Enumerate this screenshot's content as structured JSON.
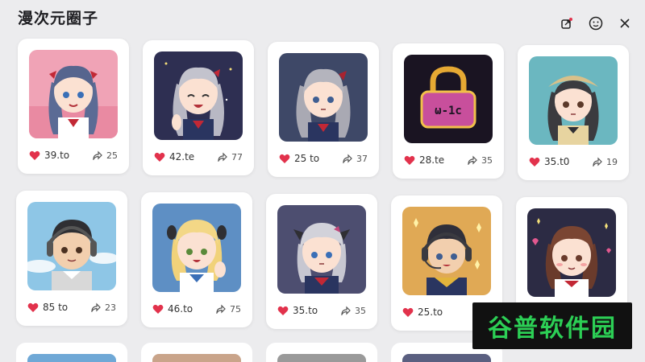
{
  "app": {
    "title": "漫次元圈子"
  },
  "toolbar": {
    "icons": [
      "share-notify-icon",
      "smile-icon",
      "close-icon"
    ]
  },
  "cards": [
    {
      "likes": "39.to",
      "shares": "25",
      "art": "twin-tail-girl-pink-bg"
    },
    {
      "likes": "42.te",
      "shares": "77",
      "art": "silver-hair-girl-night-bg"
    },
    {
      "likes": "25 to",
      "shares": "37",
      "art": "grey-twin-tail-girl-navy-bg"
    },
    {
      "likes": "28.te",
      "shares": "35",
      "art": "neon-padlock"
    },
    {
      "likes": "35.t0",
      "shares": "19",
      "art": "beret-girl-teal-bg"
    },
    {
      "likes": "85 to",
      "shares": "23",
      "art": "headphone-boy-sky-bg"
    },
    {
      "likes": "46.to",
      "shares": "75",
      "art": "blonde-girl-blue-bg"
    },
    {
      "likes": "35.to",
      "shares": "35",
      "art": "white-hair-girl-purple-bg"
    },
    {
      "likes": "25.to",
      "shares": "",
      "art": "headset-boy-yellow-bg"
    },
    {
      "likes": "",
      "shares": "",
      "art": "brown-hair-girl-dark-bg"
    }
  ],
  "watermark": {
    "text": "谷普软件园"
  },
  "colors": {
    "heart": "#e2324c",
    "background": "#ececee",
    "card": "#ffffff",
    "watermark_text": "#2ccf55"
  }
}
